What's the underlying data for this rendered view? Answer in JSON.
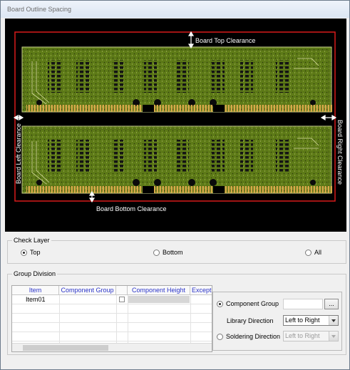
{
  "window": {
    "title": "Board Outline Spacing"
  },
  "preview": {
    "labels": {
      "top": "Board Top Clearance",
      "bottom": "Board Bottom Clearance",
      "left": "Board Left Clearance",
      "right": "Board Right Clearance"
    },
    "colors": {
      "background": "#000000",
      "outline": "#d71a1a",
      "board": "#5d7a17",
      "pads": "#d9a84a"
    }
  },
  "check_layer": {
    "label": "Check Layer",
    "options": [
      {
        "label": "Top",
        "selected": true
      },
      {
        "label": "Bottom",
        "selected": false
      },
      {
        "label": "All",
        "selected": false
      }
    ]
  },
  "group_division": {
    "label": "Group Division",
    "grid": {
      "columns": [
        "Item",
        "Component Group",
        "",
        "Component Height",
        "Except"
      ],
      "rows": [
        {
          "item": "Item01",
          "group": "",
          "checked": false,
          "height": ""
        }
      ]
    },
    "panel": {
      "component_group": {
        "label": "Component Group",
        "selected": true,
        "value": "",
        "browse_label": "..."
      },
      "library_direction": {
        "label": "Library Direction",
        "value": "Left to Right"
      },
      "soldering_direction": {
        "label": "Soldering Direction",
        "selected": false,
        "value": "Left to Right"
      }
    }
  }
}
